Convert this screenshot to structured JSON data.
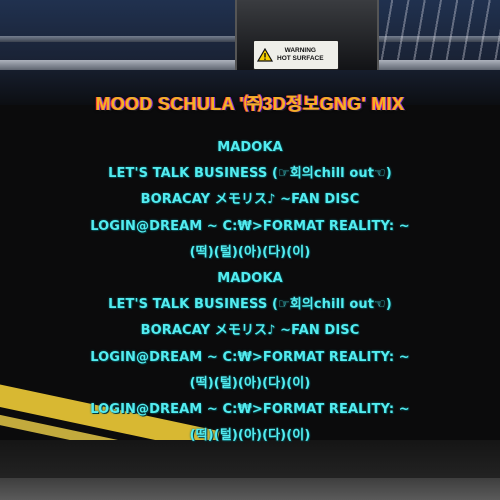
{
  "header": {
    "title": "MOOD SCHULA '㈜3D정보GNG' MIX"
  },
  "background": {
    "warning_label": [
      "WARNING",
      "HOT SURFACE"
    ],
    "colors": {
      "title": "#f2b228",
      "track_text": "#53ecf0",
      "warning_stripe": "#e4c235"
    }
  },
  "tracklist": [
    "MADOKA",
    "LET'S TALK BUSINESS (☞회의chill out☜)",
    "BORACAY メモリス♪ ~FAN DISC",
    "LOGIN@DREAM ~ C:₩>FORMAT REALITY: ~",
    "(떡)(털)(아)(다)(이)",
    "MADOKA",
    "LET'S TALK BUSINESS (☞회의chill out☜)",
    "BORACAY メモリス♪ ~FAN DISC",
    "LOGIN@DREAM ~ C:₩>FORMAT REALITY: ~",
    "(떡)(털)(아)(다)(이)",
    "LOGIN@DREAM ~ C:₩>FORMAT REALITY: ~",
    "(떡)(털)(아)(다)(이)"
  ]
}
